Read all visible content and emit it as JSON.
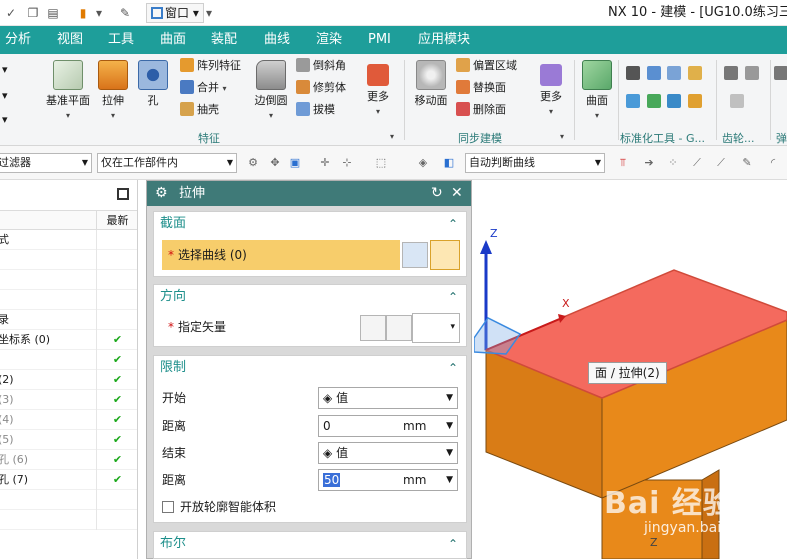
{
  "title_bar": {
    "window_menu_label": "窗口",
    "title": "NX 10 - 建模 - [UG10.0练习三"
  },
  "menu": {
    "items": [
      "分析",
      "视图",
      "工具",
      "曲面",
      "装配",
      "曲线",
      "渲染",
      "PMI",
      "应用模块"
    ]
  },
  "ribbon": {
    "datum_plane": "基准平面",
    "extrude": "拉伸",
    "hole": "孔",
    "pattern_feature": "阵列特征",
    "unite": "合并",
    "shell": "抽壳",
    "edge_blend": "边倒圆",
    "chamfer": "倒斜角",
    "trim_body": "修剪体",
    "draft": "拔模",
    "more_1": "更多",
    "feature_group": "特征",
    "move_face": "移动面",
    "offset_region": "偏置区域",
    "replace_face": "替换面",
    "delete_face": "删除面",
    "more_2": "更多",
    "sync_group": "同步建模",
    "surface": "曲面",
    "std_tools_group": "标准化工具 - G...",
    "gear_group": "齿轮...",
    "spring_group": "弹"
  },
  "filter_bar": {
    "filter": "过滤器",
    "scope": "仅在工作部件内",
    "curve_rule": "自动判断曲线"
  },
  "navigator": {
    "col_latest": "最新",
    "rows": [
      {
        "label": "式",
        "check": false,
        "grey": false
      },
      {
        "label": "",
        "check": false,
        "grey": false
      },
      {
        "label": "",
        "check": false,
        "grey": false
      },
      {
        "label": "",
        "check": false,
        "grey": false
      },
      {
        "label": "录",
        "check": false,
        "grey": false
      },
      {
        "label": "坐标系 (0)",
        "check": true,
        "grey": false
      },
      {
        "label": "",
        "check": true,
        "grey": false
      },
      {
        "label": "(2)",
        "check": true,
        "grey": false
      },
      {
        "label": "(3)",
        "check": true,
        "grey": true
      },
      {
        "label": "(4)",
        "check": true,
        "grey": true
      },
      {
        "label": "(5)",
        "check": true,
        "grey": true
      },
      {
        "label": "孔 (6)",
        "check": true,
        "grey": true
      },
      {
        "label": "孔 (7)",
        "check": true,
        "grey": false
      },
      {
        "label": "",
        "check": false,
        "grey": false
      },
      {
        "label": "",
        "check": false,
        "grey": false
      }
    ],
    "check_glyph": "✔"
  },
  "dialog": {
    "title": "拉伸",
    "section_label": "截面",
    "select_curve": "选择曲线 (0)",
    "direction_label": "方向",
    "specify_vector": "指定矢量",
    "limits_label": "限制",
    "start_label": "开始",
    "start_type": "值",
    "distance_label": "距离",
    "start_distance": "0",
    "unit": "mm",
    "end_label": "结束",
    "end_type": "值",
    "end_distance": "50",
    "open_profile": "开放轮廓智能体积",
    "boolean_label": "布尔"
  },
  "viewport": {
    "tooltip": "面 / 拉伸(2)",
    "axis_z": "Z",
    "axis_x": "X",
    "axis_z_bottom": "Z",
    "watermark": "Bai 经验",
    "watermark_url": "jingyan.baidu.com"
  },
  "colors": {
    "menu_bar": "#1e9e9a",
    "dialog_title": "#3f7a78",
    "selected_face": "#f46a5e",
    "solid": "#e8891a",
    "highlight_row": "#f7cd6b"
  }
}
